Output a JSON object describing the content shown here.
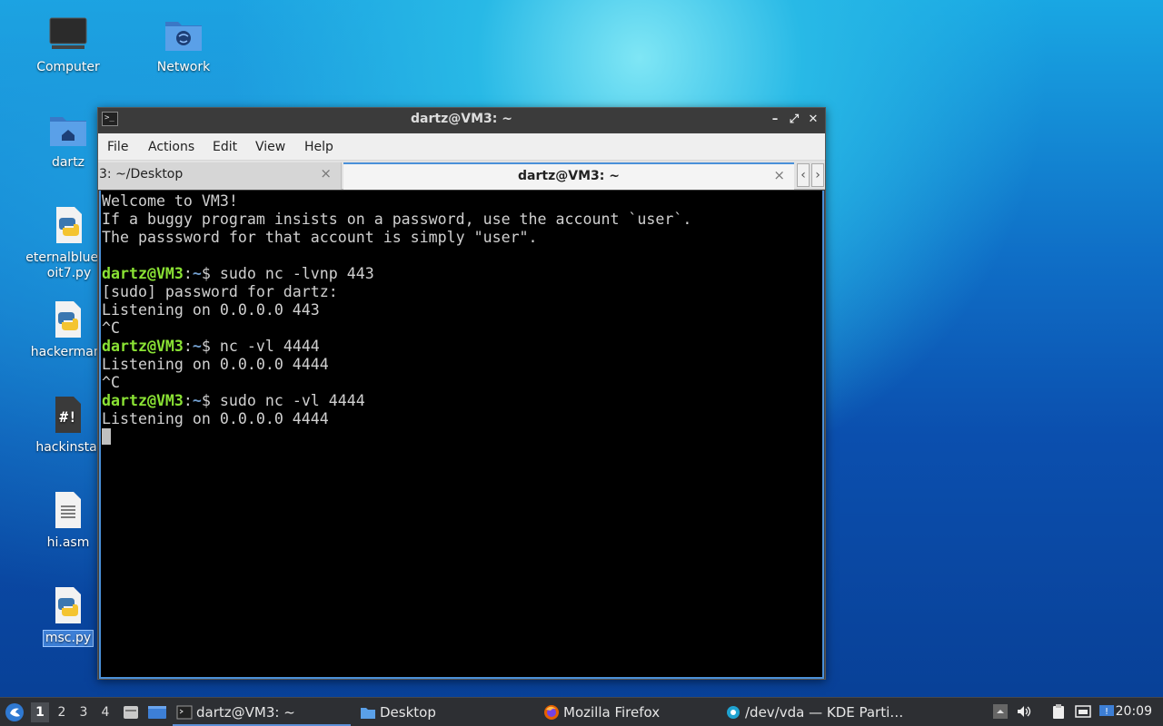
{
  "desktop": {
    "icons": [
      {
        "label": "Computer"
      },
      {
        "label": "Network"
      },
      {
        "label": "dartz"
      },
      {
        "label": "eternalblue_e"
      },
      {
        "label2": "oit7.py"
      },
      {
        "label": "hackerman."
      },
      {
        "label": "hackinstal"
      },
      {
        "label": "hi.asm"
      },
      {
        "label": "msc.py"
      }
    ]
  },
  "window": {
    "title": "dartz@VM3: ~",
    "controls": {
      "minimize": "–",
      "maximize": "⤢",
      "close": "✕"
    },
    "menu": [
      "File",
      "Actions",
      "Edit",
      "View",
      "Help"
    ],
    "tabs": [
      {
        "label": "3: ~/Desktop",
        "close": "×"
      },
      {
        "label": "dartz@VM3: ~",
        "close": "×"
      }
    ],
    "tab_nav": {
      "prev": "‹",
      "next": "›"
    }
  },
  "terminal": {
    "lines": [
      {
        "text": "Welcome to VM3!"
      },
      {
        "text": "If a buggy program insists on a password, use the account `user`."
      },
      {
        "text": "The passsword for that account is simply \"user\"."
      },
      {
        "text": ""
      },
      {
        "user": "dartz@VM3",
        "path": "~",
        "cmd": "$ sudo nc -lvnp 443"
      },
      {
        "text": "[sudo] password for dartz:"
      },
      {
        "text": "Listening on 0.0.0.0 443"
      },
      {
        "text": "^C"
      },
      {
        "user": "dartz@VM3",
        "path": "~",
        "cmd": "$ nc -vl 4444"
      },
      {
        "text": "Listening on 0.0.0.0 4444"
      },
      {
        "text": "^C"
      },
      {
        "user": "dartz@VM3",
        "path": "~",
        "cmd": "$ sudo nc -vl 4444"
      },
      {
        "text": "Listening on 0.0.0.0 4444"
      }
    ],
    "colors": {
      "user": "#8ae234",
      "path": "#729fcf",
      "text": "#d0d0d0"
    }
  },
  "taskbar": {
    "workspaces": [
      "1",
      "2",
      "3",
      "4"
    ],
    "active_workspace": "1",
    "tasks": [
      {
        "label": "dartz@VM3: ~",
        "icon": "terminal-icon"
      },
      {
        "label": "Desktop",
        "icon": "folder-icon"
      },
      {
        "label": "Mozilla Firefox",
        "icon": "firefox-icon"
      },
      {
        "label": "/dev/vda — KDE Parti…",
        "icon": "partition-manager-icon"
      }
    ],
    "clock": "20:09"
  }
}
